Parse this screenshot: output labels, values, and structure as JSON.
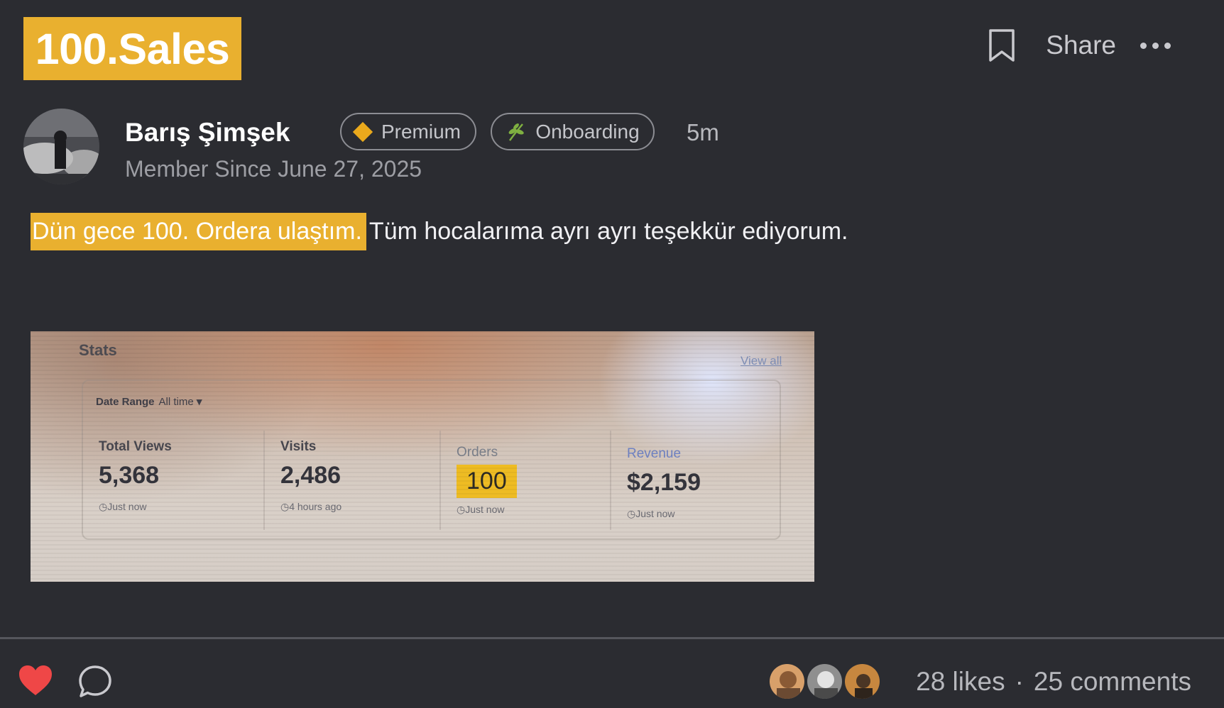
{
  "header": {
    "title": "100.Sales",
    "share_label": "Share"
  },
  "author": {
    "name": "Barış Şimşek",
    "member_since": "Member Since June 27, 2025",
    "badges": [
      {
        "label": "Premium",
        "icon": "diamond-icon",
        "color": "#eaa91c"
      },
      {
        "label": "Onboarding",
        "icon": "sprout-icon",
        "color": "#7fb041"
      }
    ],
    "time_ago": "5m"
  },
  "post": {
    "highlighted_text": "Dün gece 100. Ordera ulaştım.",
    "text": "Tüm hocalarıma ayrı ayrı teşekkür ediyorum."
  },
  "attached_screenshot": {
    "stats_title": "Stats",
    "view_all": "View all",
    "date_range_label": "Date Range",
    "date_range_value": "All time",
    "stats": [
      {
        "label": "Total Views",
        "value": "5,368",
        "updated": "Just now"
      },
      {
        "label": "Visits",
        "value": "2,486",
        "updated": "4 hours ago"
      },
      {
        "label": "Orders",
        "value": "100",
        "updated": "Just now"
      },
      {
        "label": "Revenue",
        "value": "$2,159",
        "updated": "Just now"
      }
    ]
  },
  "footer": {
    "likes": "28 likes",
    "separator": "·",
    "comments": "25 comments"
  },
  "colors": {
    "accent": "#e9b02f",
    "background": "#2b2c31",
    "heart": "#ef4747"
  }
}
